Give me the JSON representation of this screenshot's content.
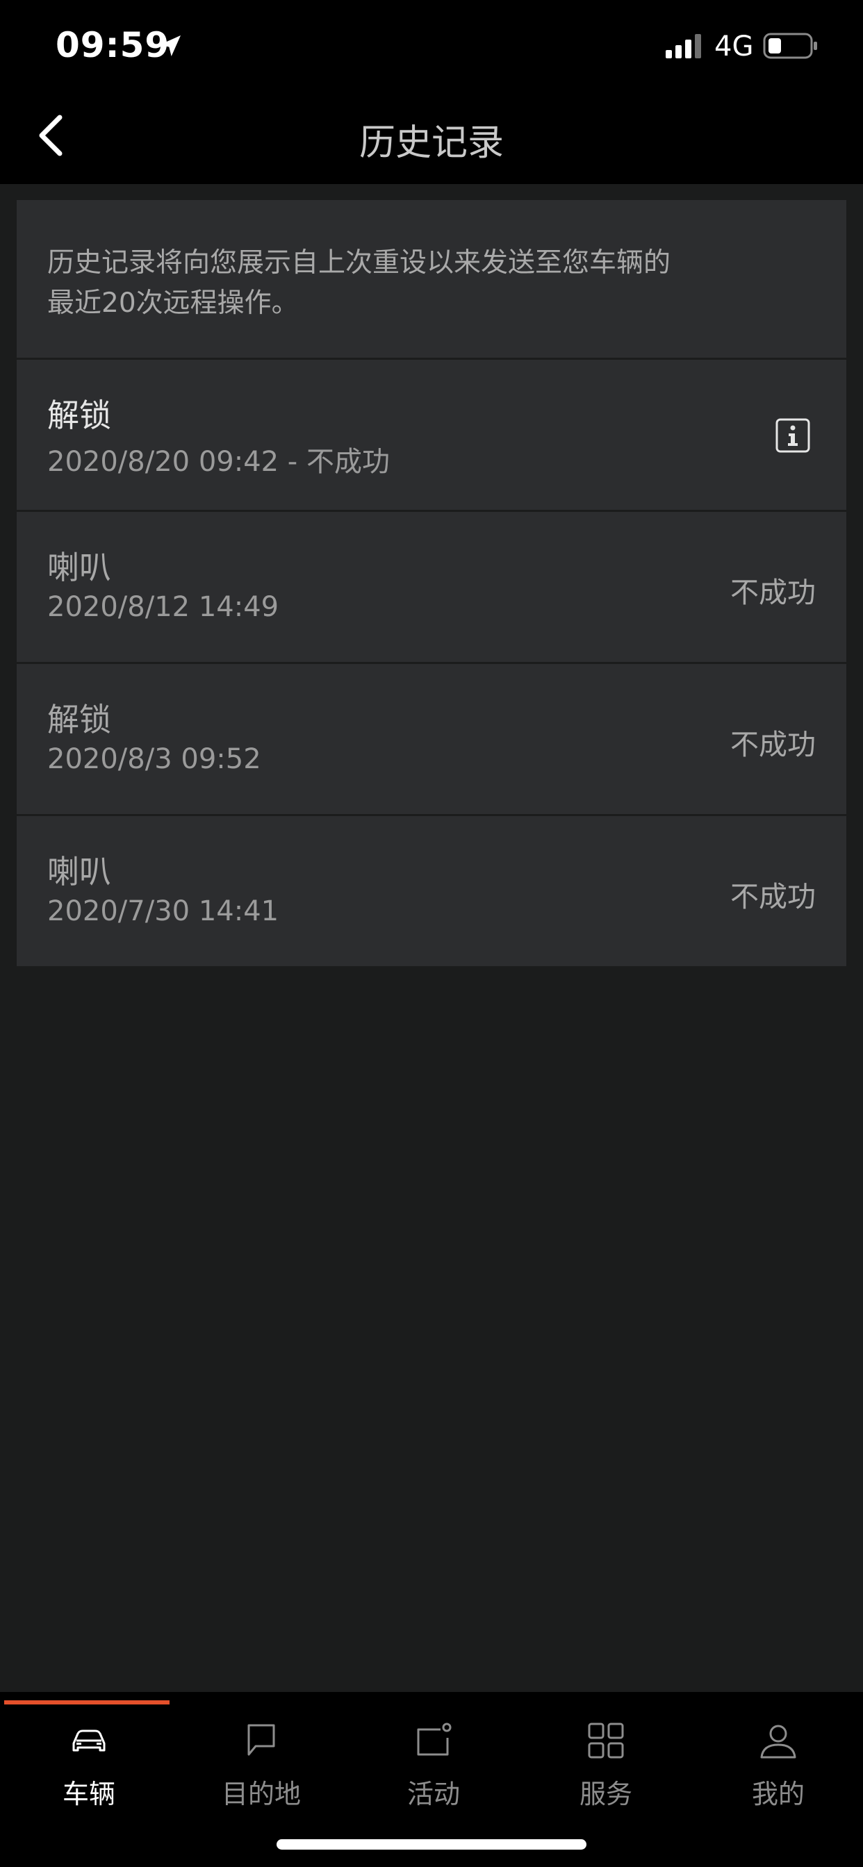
{
  "status_bar": {
    "time": "09:59",
    "network": "4G",
    "icons": {
      "location": "location-arrow-icon",
      "signal": "cellular-signal-icon",
      "battery": "battery-icon"
    }
  },
  "header": {
    "title": "历史记录",
    "back_icon": "chevron-left-icon"
  },
  "intro": {
    "line1": "历史记录将向您展示自上次重设以来发送至您车辆的",
    "line2": "最近20次远程操作。"
  },
  "history": [
    {
      "action": "解锁",
      "datetime": "2020/8/20 09:42 - 不成功",
      "status": "",
      "has_info_icon": true
    },
    {
      "action": "喇叭",
      "datetime": "2020/8/12 14:49",
      "status": "不成功"
    },
    {
      "action": "解锁",
      "datetime": "2020/8/3 09:52",
      "status": "不成功"
    },
    {
      "action": "喇叭",
      "datetime": "2020/7/30 14:41",
      "status": "不成功"
    }
  ],
  "tabs": [
    {
      "label": "车辆",
      "icon": "car-icon",
      "active": true
    },
    {
      "label": "目的地",
      "icon": "chat-bubble-icon",
      "active": false
    },
    {
      "label": "活动",
      "icon": "calendar-notification-icon",
      "active": false
    },
    {
      "label": "服务",
      "icon": "grid-icon",
      "active": false
    },
    {
      "label": "我的",
      "icon": "user-icon",
      "active": false
    }
  ],
  "colors": {
    "accent": "#e4502b",
    "background": "#1b1c1c",
    "card": "#2c2d2f"
  }
}
